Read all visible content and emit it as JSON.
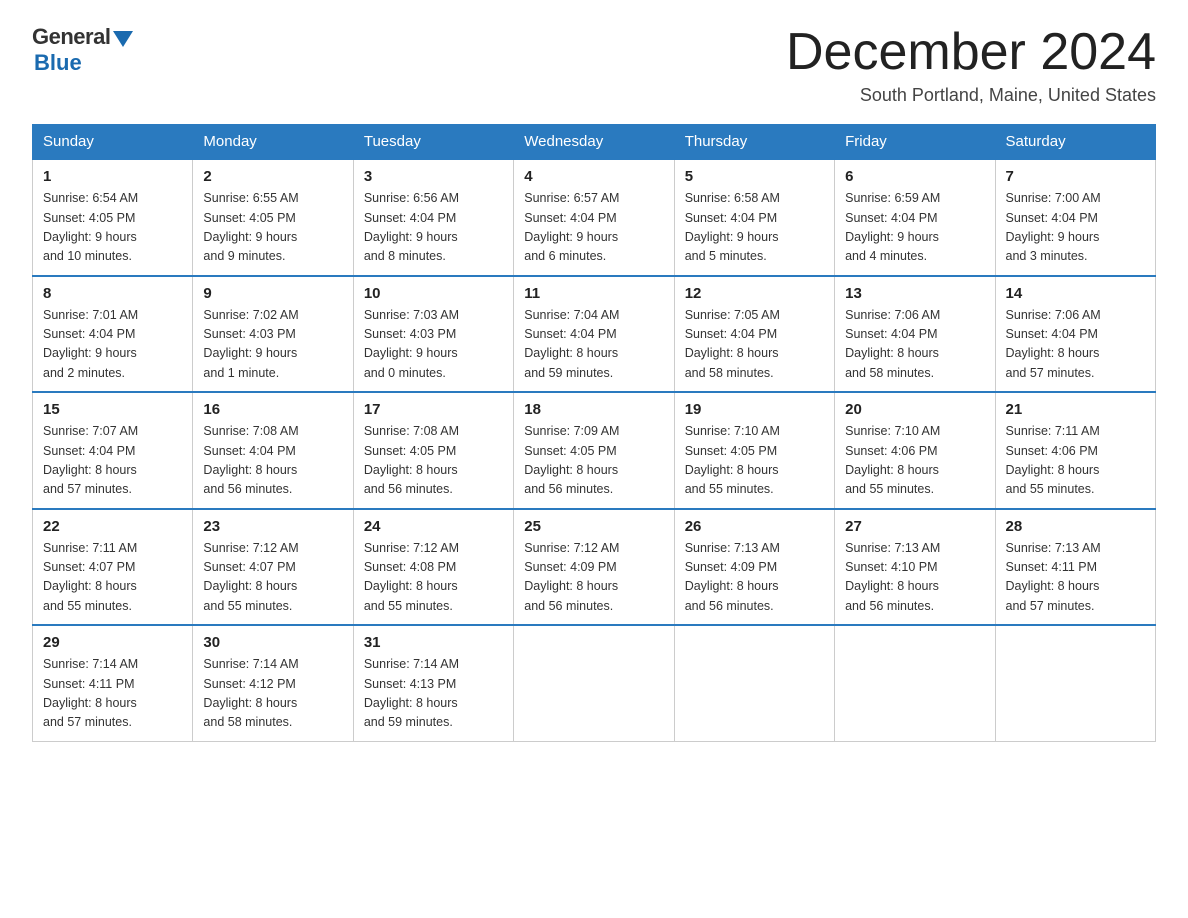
{
  "header": {
    "logo_general": "General",
    "logo_blue": "Blue",
    "month_title": "December 2024",
    "location": "South Portland, Maine, United States"
  },
  "weekdays": [
    "Sunday",
    "Monday",
    "Tuesday",
    "Wednesday",
    "Thursday",
    "Friday",
    "Saturday"
  ],
  "weeks": [
    [
      {
        "day": "1",
        "sunrise": "6:54 AM",
        "sunset": "4:05 PM",
        "daylight": "9 hours and 10 minutes."
      },
      {
        "day": "2",
        "sunrise": "6:55 AM",
        "sunset": "4:05 PM",
        "daylight": "9 hours and 9 minutes."
      },
      {
        "day": "3",
        "sunrise": "6:56 AM",
        "sunset": "4:04 PM",
        "daylight": "9 hours and 8 minutes."
      },
      {
        "day": "4",
        "sunrise": "6:57 AM",
        "sunset": "4:04 PM",
        "daylight": "9 hours and 6 minutes."
      },
      {
        "day": "5",
        "sunrise": "6:58 AM",
        "sunset": "4:04 PM",
        "daylight": "9 hours and 5 minutes."
      },
      {
        "day": "6",
        "sunrise": "6:59 AM",
        "sunset": "4:04 PM",
        "daylight": "9 hours and 4 minutes."
      },
      {
        "day": "7",
        "sunrise": "7:00 AM",
        "sunset": "4:04 PM",
        "daylight": "9 hours and 3 minutes."
      }
    ],
    [
      {
        "day": "8",
        "sunrise": "7:01 AM",
        "sunset": "4:04 PM",
        "daylight": "9 hours and 2 minutes."
      },
      {
        "day": "9",
        "sunrise": "7:02 AM",
        "sunset": "4:03 PM",
        "daylight": "9 hours and 1 minute."
      },
      {
        "day": "10",
        "sunrise": "7:03 AM",
        "sunset": "4:03 PM",
        "daylight": "9 hours and 0 minutes."
      },
      {
        "day": "11",
        "sunrise": "7:04 AM",
        "sunset": "4:04 PM",
        "daylight": "8 hours and 59 minutes."
      },
      {
        "day": "12",
        "sunrise": "7:05 AM",
        "sunset": "4:04 PM",
        "daylight": "8 hours and 58 minutes."
      },
      {
        "day": "13",
        "sunrise": "7:06 AM",
        "sunset": "4:04 PM",
        "daylight": "8 hours and 58 minutes."
      },
      {
        "day": "14",
        "sunrise": "7:06 AM",
        "sunset": "4:04 PM",
        "daylight": "8 hours and 57 minutes."
      }
    ],
    [
      {
        "day": "15",
        "sunrise": "7:07 AM",
        "sunset": "4:04 PM",
        "daylight": "8 hours and 57 minutes."
      },
      {
        "day": "16",
        "sunrise": "7:08 AM",
        "sunset": "4:04 PM",
        "daylight": "8 hours and 56 minutes."
      },
      {
        "day": "17",
        "sunrise": "7:08 AM",
        "sunset": "4:05 PM",
        "daylight": "8 hours and 56 minutes."
      },
      {
        "day": "18",
        "sunrise": "7:09 AM",
        "sunset": "4:05 PM",
        "daylight": "8 hours and 56 minutes."
      },
      {
        "day": "19",
        "sunrise": "7:10 AM",
        "sunset": "4:05 PM",
        "daylight": "8 hours and 55 minutes."
      },
      {
        "day": "20",
        "sunrise": "7:10 AM",
        "sunset": "4:06 PM",
        "daylight": "8 hours and 55 minutes."
      },
      {
        "day": "21",
        "sunrise": "7:11 AM",
        "sunset": "4:06 PM",
        "daylight": "8 hours and 55 minutes."
      }
    ],
    [
      {
        "day": "22",
        "sunrise": "7:11 AM",
        "sunset": "4:07 PM",
        "daylight": "8 hours and 55 minutes."
      },
      {
        "day": "23",
        "sunrise": "7:12 AM",
        "sunset": "4:07 PM",
        "daylight": "8 hours and 55 minutes."
      },
      {
        "day": "24",
        "sunrise": "7:12 AM",
        "sunset": "4:08 PM",
        "daylight": "8 hours and 55 minutes."
      },
      {
        "day": "25",
        "sunrise": "7:12 AM",
        "sunset": "4:09 PM",
        "daylight": "8 hours and 56 minutes."
      },
      {
        "day": "26",
        "sunrise": "7:13 AM",
        "sunset": "4:09 PM",
        "daylight": "8 hours and 56 minutes."
      },
      {
        "day": "27",
        "sunrise": "7:13 AM",
        "sunset": "4:10 PM",
        "daylight": "8 hours and 56 minutes."
      },
      {
        "day": "28",
        "sunrise": "7:13 AM",
        "sunset": "4:11 PM",
        "daylight": "8 hours and 57 minutes."
      }
    ],
    [
      {
        "day": "29",
        "sunrise": "7:14 AM",
        "sunset": "4:11 PM",
        "daylight": "8 hours and 57 minutes."
      },
      {
        "day": "30",
        "sunrise": "7:14 AM",
        "sunset": "4:12 PM",
        "daylight": "8 hours and 58 minutes."
      },
      {
        "day": "31",
        "sunrise": "7:14 AM",
        "sunset": "4:13 PM",
        "daylight": "8 hours and 59 minutes."
      },
      null,
      null,
      null,
      null
    ]
  ],
  "labels": {
    "sunrise": "Sunrise:",
    "sunset": "Sunset:",
    "daylight": "Daylight:"
  }
}
